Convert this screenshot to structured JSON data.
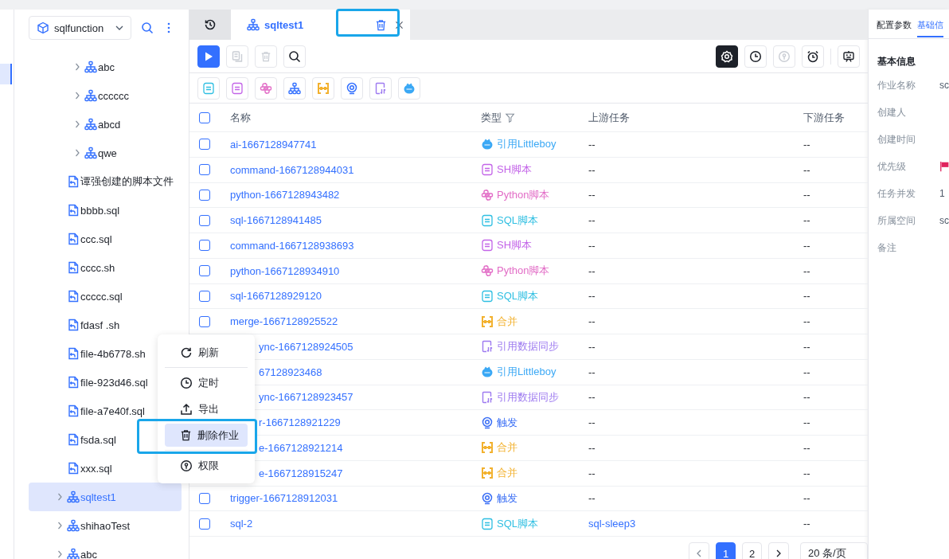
{
  "sidebar": {
    "workspace_select": {
      "value": "sqlfunction"
    },
    "nested_items": [
      {
        "label": "abc",
        "kind": "flow",
        "expanded": false,
        "selected": false
      },
      {
        "label": "cccccc",
        "kind": "flow",
        "expanded": false,
        "selected": false
      },
      {
        "label": "abcd",
        "kind": "flow",
        "expanded": false,
        "selected": false
      },
      {
        "label": "qwe",
        "kind": "flow",
        "expanded": false,
        "selected": false
      }
    ],
    "tree": [
      {
        "label": "谭强创建的脚本文件",
        "kind": "file",
        "selected": false
      },
      {
        "label": "bbbb.sql",
        "kind": "file",
        "selected": false
      },
      {
        "label": "ccc.sql",
        "kind": "file",
        "selected": false
      },
      {
        "label": "cccc.sh",
        "kind": "file",
        "selected": false
      },
      {
        "label": "ccccc.sql",
        "kind": "file",
        "selected": false
      },
      {
        "label": "fdasf .sh",
        "kind": "file",
        "selected": false
      },
      {
        "label": "file-4b6778.sh",
        "kind": "file",
        "selected": false
      },
      {
        "label": "file-923d46.sql",
        "kind": "file",
        "selected": false
      },
      {
        "label": "file-a7e40f.sql",
        "kind": "file",
        "selected": false
      },
      {
        "label": "fsda.sql",
        "kind": "file",
        "selected": false
      },
      {
        "label": "xxx.sql",
        "kind": "file",
        "selected": false
      },
      {
        "label": "sqltest1",
        "kind": "flow",
        "expanded": false,
        "selected": true
      },
      {
        "label": "shihaoTest",
        "kind": "flow",
        "expanded": false,
        "selected": false
      },
      {
        "label": "abc",
        "kind": "flow",
        "expanded": false,
        "selected": false
      }
    ]
  },
  "tabs": [
    {
      "kind": "history",
      "selected": false
    },
    {
      "kind": "flow",
      "label": "sqltest1",
      "selected": true
    }
  ],
  "toolbar": {
    "actions": [
      {
        "kind": "run",
        "disabled": false
      },
      {
        "kind": "copy",
        "disabled": true
      },
      {
        "kind": "delete",
        "disabled": true
      },
      {
        "kind": "search",
        "disabled": false
      }
    ],
    "tools": [
      {
        "kind": "settings",
        "selected": true,
        "disabled": false
      },
      {
        "kind": "clock",
        "selected": false,
        "disabled": false
      },
      {
        "kind": "permission",
        "selected": false,
        "disabled": true
      },
      {
        "kind": "alarm",
        "selected": false,
        "disabled": false
      },
      {
        "kind": "monitor",
        "selected": false,
        "disabled": false
      }
    ]
  },
  "node_palette": [
    {
      "kind": "sql"
    },
    {
      "kind": "sh"
    },
    {
      "kind": "python"
    },
    {
      "kind": "flow"
    },
    {
      "kind": "merge"
    },
    {
      "kind": "trigger"
    },
    {
      "kind": "datasync"
    },
    {
      "kind": "littleboy"
    }
  ],
  "table": {
    "header_checked": false,
    "columns": [
      "名称",
      "类型",
      "上游任务",
      "下游任务"
    ],
    "rows": [
      {
        "name": "ai-1667128947741",
        "checked": false,
        "type": {
          "kind": "littleboy",
          "label": "引用Littleboy",
          "color": "#3aa8f5"
        },
        "upstream": {
          "text": "--",
          "link": false
        },
        "downstream": "--"
      },
      {
        "name": "command-1667128944031",
        "checked": false,
        "type": {
          "kind": "sh",
          "label": "SH脚本",
          "color": "#c364e8"
        },
        "upstream": {
          "text": "--",
          "link": false
        },
        "downstream": "--"
      },
      {
        "name": "python-1667128943482",
        "checked": false,
        "type": {
          "kind": "python",
          "label": "Python脚本",
          "color": "#e26cc6"
        },
        "upstream": {
          "text": "--",
          "link": false
        },
        "downstream": "--"
      },
      {
        "name": "sql-1667128941485",
        "checked": false,
        "type": {
          "kind": "sql",
          "label": "SQL脚本",
          "color": "#2fbfe2"
        },
        "upstream": {
          "text": "--",
          "link": false
        },
        "downstream": "--"
      },
      {
        "name": "command-1667128938693",
        "checked": false,
        "type": {
          "kind": "sh",
          "label": "SH脚本",
          "color": "#c364e8"
        },
        "upstream": {
          "text": "--",
          "link": false
        },
        "downstream": "--"
      },
      {
        "name": "python-1667128934910",
        "checked": false,
        "type": {
          "kind": "python",
          "label": "Python脚本",
          "color": "#e26cc6"
        },
        "upstream": {
          "text": "--",
          "link": false
        },
        "downstream": "--"
      },
      {
        "name": "sql-1667128929120",
        "checked": false,
        "type": {
          "kind": "sql",
          "label": "SQL脚本",
          "color": "#2fbfe2"
        },
        "upstream": {
          "text": "--",
          "link": false
        },
        "downstream": "--"
      },
      {
        "name": "merge-1667128925522",
        "checked": false,
        "type": {
          "kind": "merge",
          "label": "合并",
          "color": "#f2b12e"
        },
        "upstream": {
          "text": "--",
          "link": false
        },
        "downstream": "--"
      },
      {
        "name": "ync-1667128924505",
        "type": {
          "kind": "datasync",
          "label": "引用数据同步",
          "color": "#9d7af0"
        },
        "upstream": {
          "text": "--",
          "link": false
        },
        "downstream": "--"
      },
      {
        "name": "67128923468",
        "type": {
          "kind": "littleboy",
          "label": "引用Littleboy",
          "color": "#3aa8f5"
        },
        "upstream": {
          "text": "--",
          "link": false
        },
        "downstream": "--"
      },
      {
        "name": "ync-1667128923457",
        "type": {
          "kind": "datasync",
          "label": "引用数据同步",
          "color": "#9d7af0"
        },
        "upstream": {
          "text": "--",
          "link": false
        },
        "downstream": "--"
      },
      {
        "name": "r-1667128921229",
        "type": {
          "kind": "trigger",
          "label": "触发",
          "color": "#3b6ff5"
        },
        "upstream": {
          "text": "--",
          "link": false
        },
        "downstream": "--"
      },
      {
        "name": "e-1667128921214",
        "type": {
          "kind": "merge",
          "label": "合并",
          "color": "#f2b12e"
        },
        "upstream": {
          "text": "--",
          "link": false
        },
        "downstream": "--"
      },
      {
        "name": "e-1667128915247",
        "type": {
          "kind": "merge",
          "label": "合并",
          "color": "#f2b12e"
        },
        "upstream": {
          "text": "--",
          "link": false
        },
        "downstream": "--"
      },
      {
        "name": "trigger-1667128912031",
        "checked": false,
        "type": {
          "kind": "trigger",
          "label": "触发",
          "color": "#3b6ff5"
        },
        "upstream": {
          "text": "--",
          "link": false
        },
        "downstream": "--"
      },
      {
        "name": "sql-2",
        "checked": false,
        "type": {
          "kind": "sql",
          "label": "SQL脚本",
          "color": "#2fbfe2"
        },
        "upstream": {
          "text": "sql-sleep3",
          "link": true
        },
        "downstream": "--"
      }
    ]
  },
  "pagination": {
    "pages": [
      {
        "label": "1",
        "selected": true
      },
      {
        "label": "2",
        "selected": false
      }
    ],
    "page_size": "20 条/页"
  },
  "side_panel": {
    "tabs": [
      {
        "label": "配置参数",
        "selected": false
      },
      {
        "label": "基础信",
        "selected": true
      }
    ],
    "section_title": "基本信息",
    "fields": [
      {
        "label": "作业名称",
        "kind": "text",
        "value": "sc"
      },
      {
        "label": "创建人",
        "kind": "text"
      },
      {
        "label": "创建时间",
        "kind": "text"
      },
      {
        "label": "优先级",
        "kind": "flag"
      },
      {
        "label": "任务并发",
        "kind": "text",
        "value": "1"
      },
      {
        "label": "所属空间",
        "kind": "text",
        "value": "sc"
      },
      {
        "label": "备注",
        "kind": "text"
      }
    ]
  },
  "context_menu": {
    "items": [
      {
        "kind": "refresh",
        "label": "刷新",
        "selected": false
      },
      {
        "kind": "schedule",
        "label": "定时",
        "selected": false
      },
      {
        "kind": "export",
        "label": "导出",
        "selected": false
      },
      {
        "kind": "delete",
        "label": "删除作业",
        "selected": true
      },
      {
        "kind": "permission",
        "label": "权限",
        "selected": false
      }
    ]
  }
}
